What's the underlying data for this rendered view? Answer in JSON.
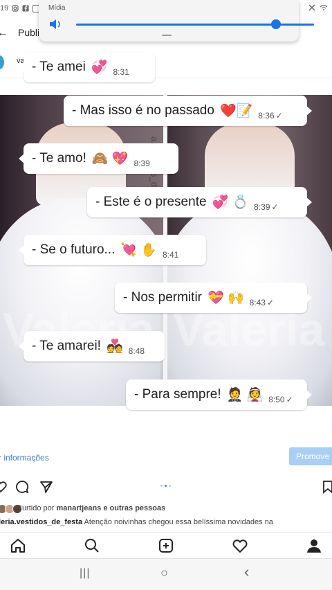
{
  "statusbar": {
    "time_fragment": "19"
  },
  "media_panel": {
    "label": "Mídia",
    "volume_level": 0.88,
    "accent": "#1a73e8"
  },
  "header": {
    "title": "Publicações"
  },
  "profile": {
    "name_fragment": "va"
  },
  "photo": {
    "watermark_left": "Valeria",
    "watermark_right": "Valeria",
    "vertical_text": "a.vestidos_de."
  },
  "chat": [
    {
      "text": "- Te amei",
      "emoji": "💞",
      "time": "8:31",
      "side": "in",
      "check": ""
    },
    {
      "text": "- Mas isso é no passado",
      "emoji": "❤️📝",
      "time": "8:36",
      "side": "out",
      "check": "✓"
    },
    {
      "text": "-  Te amo!",
      "emoji": "🙈 💖",
      "time": "8:39",
      "side": "in",
      "check": ""
    },
    {
      "text": "- Este é o presente",
      "emoji": "💞 💍",
      "time": "8:39",
      "side": "out",
      "check": "✓"
    },
    {
      "text": "-  Se o futuro...",
      "emoji": "💘 ✋",
      "time": "8:41",
      "side": "in",
      "check": ""
    },
    {
      "text": "-  Nos permitir",
      "emoji": "💝 🙌",
      "time": "8:43",
      "side": "out",
      "check": "✓"
    },
    {
      "text": "- Te amarei!",
      "emoji": "💑",
      "time": "8:48",
      "side": "in",
      "check": ""
    },
    {
      "text": "- Para sempre!",
      "emoji": "🤵 👰",
      "time": "8:50",
      "side": "out",
      "check": "✓"
    }
  ],
  "post": {
    "more_info": "r informações",
    "promote": "Promove",
    "liked_prefix": "Curtido por",
    "liked_user": "manartjeans",
    "liked_suffix": "e outras pessoas",
    "caption_user": "leria.vestidos_de_festa",
    "caption_text": "Atenção noivinhas chegou essa belíssima novidades na"
  },
  "sysnav": {
    "recents": "|||",
    "home": "○",
    "back": "‹"
  }
}
